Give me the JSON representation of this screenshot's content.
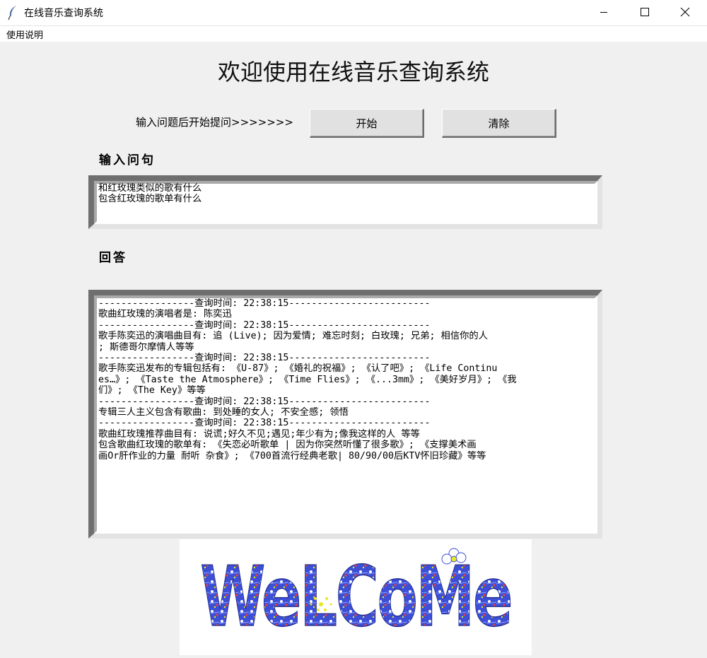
{
  "window": {
    "title": "在线音乐查询系统",
    "controls": {
      "minimize": "minimize-icon",
      "maximize": "maximize-icon",
      "close": "close-icon"
    }
  },
  "menu": {
    "items": [
      "使用说明"
    ]
  },
  "main": {
    "title": "欢迎使用在线音乐查询系统",
    "prompt_label": "输入问题后开始提问>>>>>>>",
    "start_button": "开始",
    "clear_button": "清除",
    "question_label": "输入问句",
    "answer_label": "回答"
  },
  "question_input": {
    "lines": [
      "和红玫瑰类似的歌有什么",
      "包含红玫瑰的歌单有什么"
    ]
  },
  "answer_output": {
    "lines": [
      "-----------------查询时间: 22:38:15-------------------------",
      "歌曲红玫瑰的演唱者是: 陈奕迅",
      "-----------------查询时间: 22:38:15-------------------------",
      "歌手陈奕迅的演唱曲目有: 追 (Live); 因为爱情; 难忘时刻; 白玫瑰; 兄弟; 相信你的人",
      "; 斯德哥尔摩情人等等",
      "-----------------查询时间: 22:38:15-------------------------",
      "歌手陈奕迅发布的专辑包括有: 《U-87》; 《婚礼的祝福》; 《认了吧》; 《Life Continu",
      "es…》; 《Taste the Atmosphere》; 《Time Flies》; 《...3mm》; 《美好岁月》; 《我",
      "们》; 《The Key》等等",
      "-----------------查询时间: 22:38:15-------------------------",
      "专辑三人主义包含有歌曲: 到处睡的女人; 不安全感; 领悟",
      "-----------------查询时间: 22:38:15-------------------------",
      "歌曲红玫瑰推荐曲目有: 说谎;好久不见;遇见;年少有为;像我这样的人 等等",
      "包含歌曲红玫瑰的歌单有: 《失恋必听歌单 | 因为你突然听懂了很多歌》; 《支撑美术画",
      "画Or肝作业的力量 耐听 杂食》; 《700首流行经典老歌| 80/90/00后KTV怀旧珍藏》等等"
    ]
  },
  "welcome_image": {
    "text": "WeLCoMe",
    "colors": {
      "fill": "#3c4fd6",
      "dots": "#ffffff",
      "accent": "#e8e820"
    }
  }
}
